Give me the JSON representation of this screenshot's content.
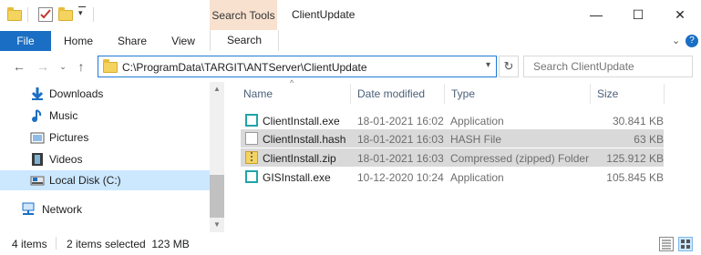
{
  "window": {
    "title": "ClientUpdate",
    "contextual_tab": "Search Tools",
    "controls": {
      "minimize": "—",
      "maximize": "☐",
      "close": "✕"
    }
  },
  "ribbon": {
    "tabs": [
      "File",
      "Home",
      "Share",
      "View",
      "Search"
    ],
    "collapse_icon": "chevron-down-icon",
    "help_icon": "?"
  },
  "address": {
    "path": "C:\\ProgramData\\TARGIT\\ANTServer\\ClientUpdate",
    "refresh_icon": "↻"
  },
  "search": {
    "placeholder": "Search ClientUpdate"
  },
  "sidebar": {
    "items": [
      {
        "label": "Downloads",
        "icon": "download-icon"
      },
      {
        "label": "Music",
        "icon": "music-icon"
      },
      {
        "label": "Pictures",
        "icon": "pictures-icon"
      },
      {
        "label": "Videos",
        "icon": "videos-icon"
      },
      {
        "label": "Local Disk (C:)",
        "icon": "drive-icon",
        "selected": true
      },
      {
        "label": "Network",
        "icon": "network-icon"
      }
    ]
  },
  "file_list": {
    "columns": [
      "Name",
      "Date modified",
      "Type",
      "Size"
    ],
    "rows": [
      {
        "name": "ClientInstall.exe",
        "date": "18-01-2021 16:02",
        "type": "Application",
        "size": "30.841 KB",
        "icon": "exe-icon",
        "selected": false
      },
      {
        "name": "ClientInstall.hash",
        "date": "18-01-2021 16:03",
        "type": "HASH File",
        "size": "63 KB",
        "icon": "file-icon",
        "selected": true
      },
      {
        "name": "ClientInstall.zip",
        "date": "18-01-2021 16:03",
        "type": "Compressed (zipped) Folder",
        "size": "125.912 KB",
        "icon": "zip-icon",
        "selected": true
      },
      {
        "name": "GISInstall.exe",
        "date": "10-12-2020 10:24",
        "type": "Application",
        "size": "105.845 KB",
        "icon": "exe-icon",
        "selected": false
      }
    ]
  },
  "status": {
    "item_count": "4 items",
    "selection": "2 items selected  123 MB"
  },
  "colors": {
    "accent": "#1a6fc4",
    "search_tools": "#f8e1cf",
    "selected_nav": "#cce8ff",
    "selected_row": "#d9d9d9"
  }
}
